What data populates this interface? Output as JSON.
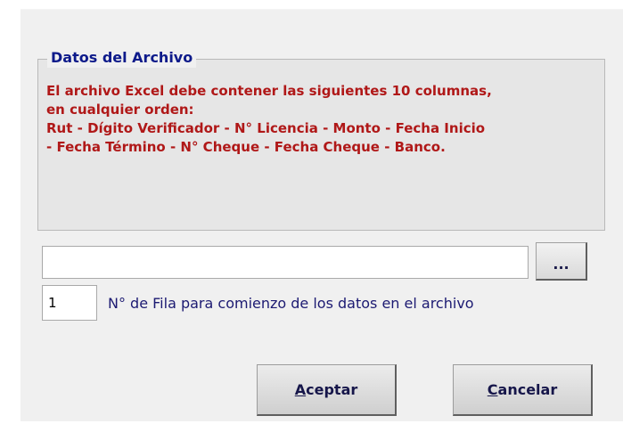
{
  "group": {
    "title": "Datos del Archivo",
    "lines": [
      "El archivo Excel debe contener las siguientes 10 columnas,",
      "en cualquier orden:",
      "Rut - Dígito Verificador - N° Licencia - Monto - Fecha Inicio",
      "- Fecha Término - N° Cheque - Fecha Cheque - Banco."
    ]
  },
  "file_path": {
    "value": "",
    "placeholder": ""
  },
  "browse_button": {
    "label": "..."
  },
  "start_row": {
    "value": "1",
    "label": "N° de Fila para comienzo de los datos en el archivo"
  },
  "buttons": {
    "accept": {
      "key": "A",
      "rest": "ceptar"
    },
    "cancel": {
      "key": "C",
      "rest": "ancelar"
    }
  },
  "colors": {
    "group_title": "#0d1a8a",
    "instruction_text": "#b01818",
    "row_label": "#1c1a72",
    "dialog_bg": "#f0f0f0"
  }
}
